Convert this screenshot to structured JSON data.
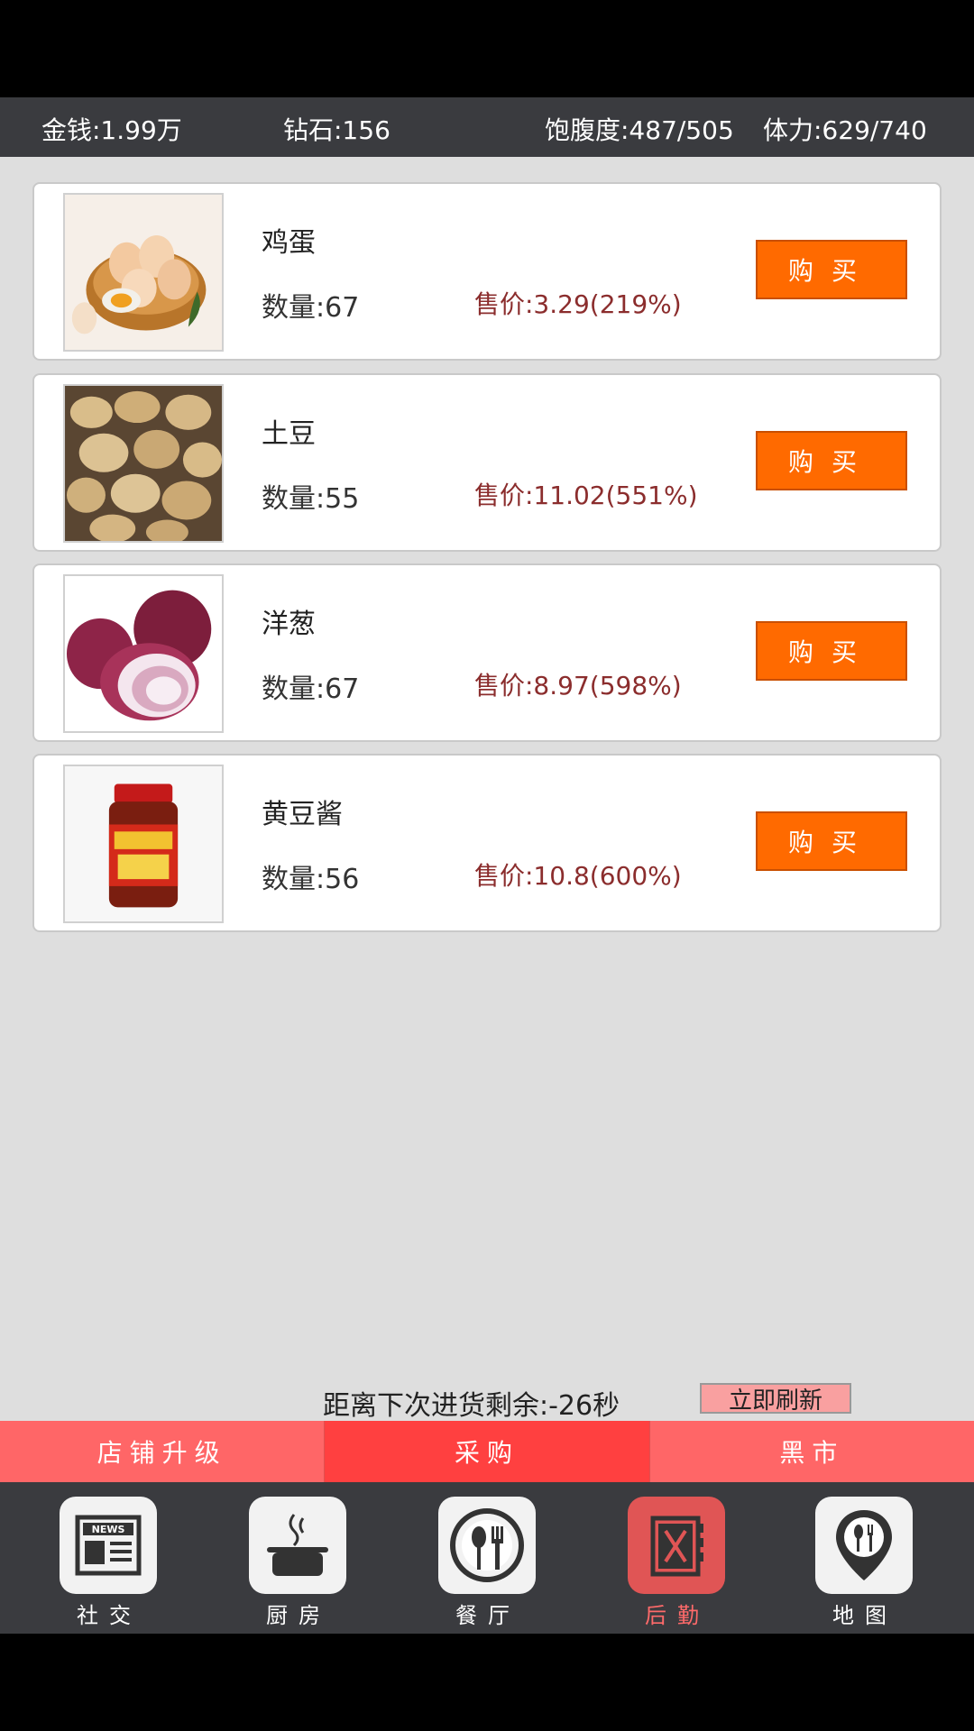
{
  "status": {
    "money": "金钱:1.99万",
    "diamonds": "钻石:156",
    "satiety": "饱腹度:487/505",
    "stamina": "体力:629/740"
  },
  "items": [
    {
      "name": "鸡蛋",
      "qty": "数量:67",
      "price": "售价:3.29(219%)",
      "buy": "购买",
      "image": "eggs"
    },
    {
      "name": "土豆",
      "qty": "数量:55",
      "price": "售价:11.02(551%)",
      "buy": "购买",
      "image": "potatoes"
    },
    {
      "name": "洋葱",
      "qty": "数量:67",
      "price": "售价:8.97(598%)",
      "buy": "购买",
      "image": "onions"
    },
    {
      "name": "黄豆酱",
      "qty": "数量:56",
      "price": "售价:10.8(600%)",
      "buy": "购买",
      "image": "soybean-paste-jar"
    }
  ],
  "timer": {
    "text": "距离下次进货剩余:-26秒",
    "refresh_label": "立即刷新"
  },
  "tabs": [
    "店铺升级",
    "采购",
    "黑市"
  ],
  "nav": [
    {
      "label": "社交",
      "icon": "news-icon"
    },
    {
      "label": "厨房",
      "icon": "pot-icon"
    },
    {
      "label": "餐厅",
      "icon": "dining-icon"
    },
    {
      "label": "后勤",
      "icon": "logistics-icon"
    },
    {
      "label": "地图",
      "icon": "map-pin-icon"
    }
  ],
  "colors": {
    "buy_button": "#ff6a00",
    "tab_active": "#ff4040",
    "tab_inactive": "#ff6667",
    "nav_active": "#e05555"
  }
}
